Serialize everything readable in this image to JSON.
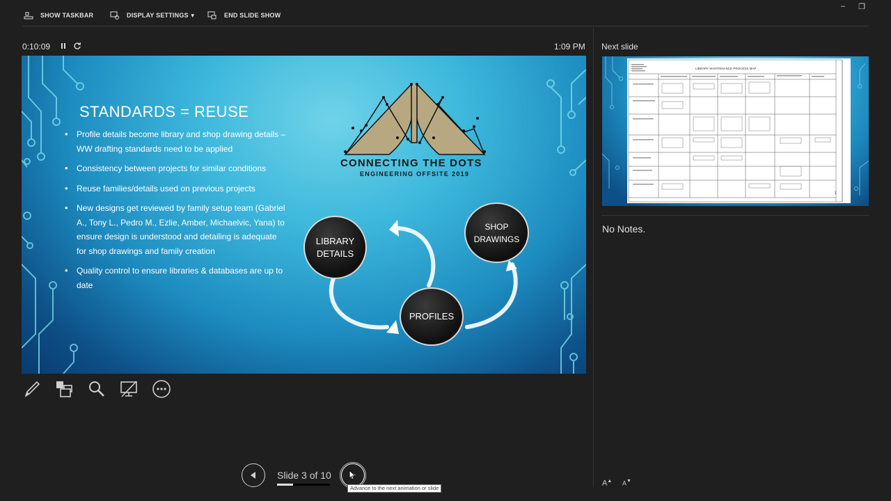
{
  "toolbar": {
    "show_taskbar": "SHOW TASKBAR",
    "display_settings": "DISPLAY SETTINGS",
    "end_slide_show": "END SLIDE SHOW"
  },
  "window": {
    "minimize": "–",
    "restore": "❐"
  },
  "presenter": {
    "elapsed": "0:10:09",
    "clock": "1:09 PM",
    "next_slide_label": "Next slide",
    "notes": "No Notes.",
    "slide_counter": "Slide 3 of 10",
    "progress_fraction": 0.3,
    "tooltip": "Advance to the next animation or slide"
  },
  "slide": {
    "title": "STANDARDS = REUSE",
    "bullets": [
      "Profile details become library and shop drawing details – WW drafting standards need to be applied",
      "Consistency between projects for similar conditions",
      "Reuse families/details used on previous projects",
      "New designs get reviewed by family setup team (Gabriel A., Tony L., Pedro M., Ezlie, Amber, Michaelvic, Yana) to ensure design is understood and detailing is adequate for shop drawings and family creation",
      "Quality control to ensure libraries & databases are up to date"
    ],
    "logo_title": "CONNECTING THE DOTS",
    "logo_subtitle": "ENGINEERING OFFSITE 2019",
    "cycle": {
      "library": "LIBRARY DETAILS",
      "shop": "SHOP DRAWINGS",
      "profiles": "PROFILES"
    }
  },
  "next_slide": {
    "doc_title": "LIBRARY MAINTENANCE PROCESS MAP"
  },
  "tools": [
    "pen-tool",
    "see-all-slides",
    "zoom-into-slide",
    "black-or-unblack-slide",
    "more-options"
  ],
  "font_controls": {
    "increase": "A",
    "decrease": "A"
  },
  "colors": {
    "background": "#1f1f1f",
    "slide_accent": "#3db8dc"
  }
}
